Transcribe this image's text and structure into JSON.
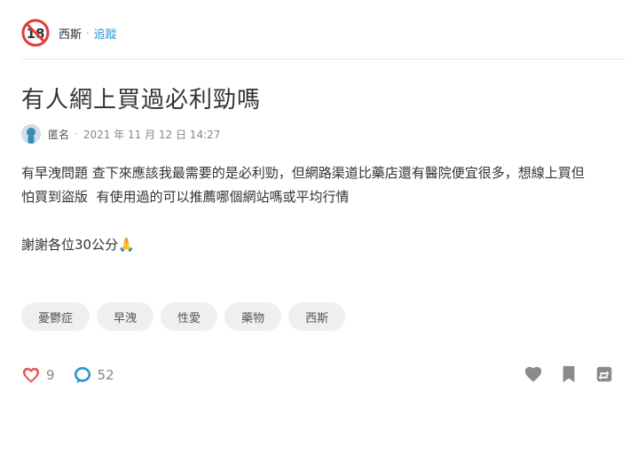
{
  "forum": {
    "badge_text": "18",
    "name": "西斯",
    "separator": "·",
    "follow_label": "追蹤"
  },
  "post": {
    "title": "有人網上買過必利勁嗎",
    "author": "匿名",
    "meta_separator": "·",
    "timestamp": "2021 年 11 月 12 日 14:27",
    "content_lines": [
      "有早洩問題 查下來應該我最需要的是必利勁，但網路渠道比藥店還有醫院便宜很多，想線上買但",
      "怕買到盜版  有使用過的可以推薦哪個網站嗎或平均行情",
      "",
      "謝謝各位30公分🙏"
    ]
  },
  "tags": [
    "憂鬱症",
    "早洩",
    "性愛",
    "藥物",
    "西斯"
  ],
  "stats": {
    "likes": "9",
    "comments": "52"
  },
  "colors": {
    "badge_red": "#e23b3b",
    "like_red": "#e25b5b",
    "comment_blue": "#3397cf",
    "action_gray": "#8a8a8a"
  },
  "icons": {
    "like": "heart-icon",
    "comment": "comment-bubble-icon",
    "save": "heart-icon",
    "bookmark": "bookmark-icon",
    "share": "share-repost-icon"
  }
}
